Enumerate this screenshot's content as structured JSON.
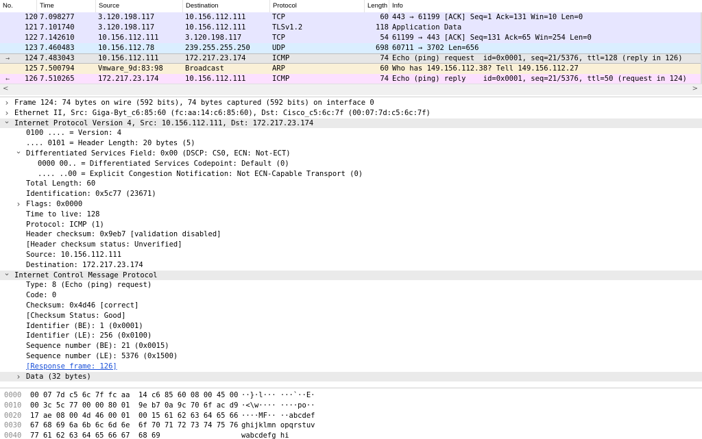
{
  "colors": {
    "tcp_row": "#e7e6ff",
    "udp_row": "#daeeff",
    "icmp_row": "#fce0ff",
    "arp_row": "#faf0d7",
    "selected_row": "#e6e6e6",
    "link": "#1a50d8"
  },
  "packet_list": {
    "columns": [
      "No.",
      "Time",
      "Source",
      "Destination",
      "Protocol",
      "Length",
      "Info"
    ],
    "rows": [
      {
        "no": "120",
        "time": "7.098277",
        "source": "3.120.198.117",
        "destination": "10.156.112.111",
        "protocol": "TCP",
        "length": "60",
        "info": "443 → 61199 [ACK] Seq=1 Ack=131 Win=10 Len=0",
        "marker": "",
        "color": "tcp"
      },
      {
        "no": "121",
        "time": "7.101740",
        "source": "3.120.198.117",
        "destination": "10.156.112.111",
        "protocol": "TLSv1.2",
        "length": "118",
        "info": "Application Data",
        "marker": "",
        "color": "tcp"
      },
      {
        "no": "122",
        "time": "7.142610",
        "source": "10.156.112.111",
        "destination": "3.120.198.117",
        "protocol": "TCP",
        "length": "54",
        "info": "61199 → 443 [ACK] Seq=131 Ack=65 Win=254 Len=0",
        "marker": "",
        "color": "tcp"
      },
      {
        "no": "123",
        "time": "7.460483",
        "source": "10.156.112.78",
        "destination": "239.255.255.250",
        "protocol": "UDP",
        "length": "698",
        "info": "60711 → 3702 Len=656",
        "marker": "",
        "color": "udp"
      },
      {
        "no": "124",
        "time": "7.483043",
        "source": "10.156.112.111",
        "destination": "172.217.23.174",
        "protocol": "ICMP",
        "length": "74",
        "info": "Echo (ping) request  id=0x0001, seq=21/5376, ttl=128 (reply in 126)",
        "marker": "→",
        "color": "selected"
      },
      {
        "no": "125",
        "time": "7.500794",
        "source": "Vmware_9d:83:98",
        "destination": "Broadcast",
        "protocol": "ARP",
        "length": "60",
        "info": "Who has 149.156.112.38? Tell 149.156.112.27",
        "marker": "",
        "color": "arp"
      },
      {
        "no": "126",
        "time": "7.510265",
        "source": "172.217.23.174",
        "destination": "10.156.112.111",
        "protocol": "ICMP",
        "length": "74",
        "info": "Echo (ping) reply    id=0x0001, seq=21/5376, ttl=50 (request in 124)",
        "marker": "←",
        "color": "icmp"
      }
    ]
  },
  "details": [
    {
      "indent": 0,
      "toggle": "collapsed",
      "text": "Frame 124: 74 bytes on wire (592 bits), 74 bytes captured (592 bits) on interface 0"
    },
    {
      "indent": 0,
      "toggle": "collapsed",
      "text": "Ethernet II, Src: Giga-Byt_c6:85:60 (fc:aa:14:c6:85:60), Dst: Cisco_c5:6c:7f (00:07:7d:c5:6c:7f)"
    },
    {
      "indent": 0,
      "toggle": "expanded",
      "text": "Internet Protocol Version 4, Src: 10.156.112.111, Dst: 172.217.23.174",
      "hl": true
    },
    {
      "indent": 1,
      "toggle": "",
      "text": "0100 .... = Version: 4"
    },
    {
      "indent": 1,
      "toggle": "",
      "text": ".... 0101 = Header Length: 20 bytes (5)"
    },
    {
      "indent": 1,
      "toggle": "expanded",
      "text": "Differentiated Services Field: 0x00 (DSCP: CS0, ECN: Not-ECT)"
    },
    {
      "indent": 2,
      "toggle": "",
      "text": "0000 00.. = Differentiated Services Codepoint: Default (0)"
    },
    {
      "indent": 2,
      "toggle": "",
      "text": ".... ..00 = Explicit Congestion Notification: Not ECN-Capable Transport (0)"
    },
    {
      "indent": 1,
      "toggle": "",
      "text": "Total Length: 60"
    },
    {
      "indent": 1,
      "toggle": "",
      "text": "Identification: 0x5c77 (23671)"
    },
    {
      "indent": 1,
      "toggle": "collapsed",
      "text": "Flags: 0x0000"
    },
    {
      "indent": 1,
      "toggle": "",
      "text": "Time to live: 128"
    },
    {
      "indent": 1,
      "toggle": "",
      "text": "Protocol: ICMP (1)"
    },
    {
      "indent": 1,
      "toggle": "",
      "text": "Header checksum: 0x9eb7 [validation disabled]"
    },
    {
      "indent": 1,
      "toggle": "",
      "text": "[Header checksum status: Unverified]"
    },
    {
      "indent": 1,
      "toggle": "",
      "text": "Source: 10.156.112.111"
    },
    {
      "indent": 1,
      "toggle": "",
      "text": "Destination: 172.217.23.174"
    },
    {
      "indent": 0,
      "toggle": "expanded",
      "text": "Internet Control Message Protocol",
      "hl": true
    },
    {
      "indent": 1,
      "toggle": "",
      "text": "Type: 8 (Echo (ping) request)"
    },
    {
      "indent": 1,
      "toggle": "",
      "text": "Code: 0"
    },
    {
      "indent": 1,
      "toggle": "",
      "text": "Checksum: 0x4d46 [correct]"
    },
    {
      "indent": 1,
      "toggle": "",
      "text": "[Checksum Status: Good]"
    },
    {
      "indent": 1,
      "toggle": "",
      "text": "Identifier (BE): 1 (0x0001)"
    },
    {
      "indent": 1,
      "toggle": "",
      "text": "Identifier (LE): 256 (0x0100)"
    },
    {
      "indent": 1,
      "toggle": "",
      "text": "Sequence number (BE): 21 (0x0015)"
    },
    {
      "indent": 1,
      "toggle": "",
      "text": "Sequence number (LE): 5376 (0x1500)"
    },
    {
      "indent": 1,
      "toggle": "",
      "text": "[Response frame: 126]",
      "link": true
    },
    {
      "indent": 1,
      "toggle": "collapsed",
      "text": "Data (32 bytes)",
      "hl": true
    }
  ],
  "bytes": [
    {
      "offset": "0000",
      "hex": "00 07 7d c5 6c 7f fc aa  14 c6 85 60 08 00 45 00",
      "ascii": "··}·l··· ···`··E·"
    },
    {
      "offset": "0010",
      "hex": "00 3c 5c 77 00 00 80 01  9e b7 0a 9c 70 6f ac d9",
      "ascii": "·<\\w···· ····po··"
    },
    {
      "offset": "0020",
      "hex": "17 ae 08 00 4d 46 00 01  00 15 61 62 63 64 65 66",
      "ascii": "····MF·· ··abcdef"
    },
    {
      "offset": "0030",
      "hex": "67 68 69 6a 6b 6c 6d 6e  6f 70 71 72 73 74 75 76",
      "ascii": "ghijklmn opqrstuv"
    },
    {
      "offset": "0040",
      "hex": "77 61 62 63 64 65 66 67  68 69",
      "ascii": "wabcdefg hi"
    }
  ]
}
